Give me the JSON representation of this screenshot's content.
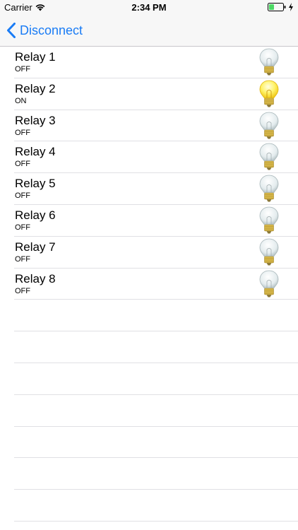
{
  "status_bar": {
    "carrier": "Carrier",
    "time": "2:34 PM",
    "battery_color": "#4cd964"
  },
  "nav": {
    "back_label": "Disconnect",
    "accent": "#1a7cf5"
  },
  "relays": [
    {
      "name": "Relay 1",
      "state": "OFF",
      "on": false
    },
    {
      "name": "Relay 2",
      "state": "ON",
      "on": true
    },
    {
      "name": "Relay 3",
      "state": "OFF",
      "on": false
    },
    {
      "name": "Relay 4",
      "state": "OFF",
      "on": false
    },
    {
      "name": "Relay 5",
      "state": "OFF",
      "on": false
    },
    {
      "name": "Relay 6",
      "state": "OFF",
      "on": false
    },
    {
      "name": "Relay 7",
      "state": "OFF",
      "on": false
    },
    {
      "name": "Relay 8",
      "state": "OFF",
      "on": false
    }
  ],
  "icons": {
    "bulb_off": "lightbulb-off-icon",
    "bulb_on": "lightbulb-on-icon"
  }
}
